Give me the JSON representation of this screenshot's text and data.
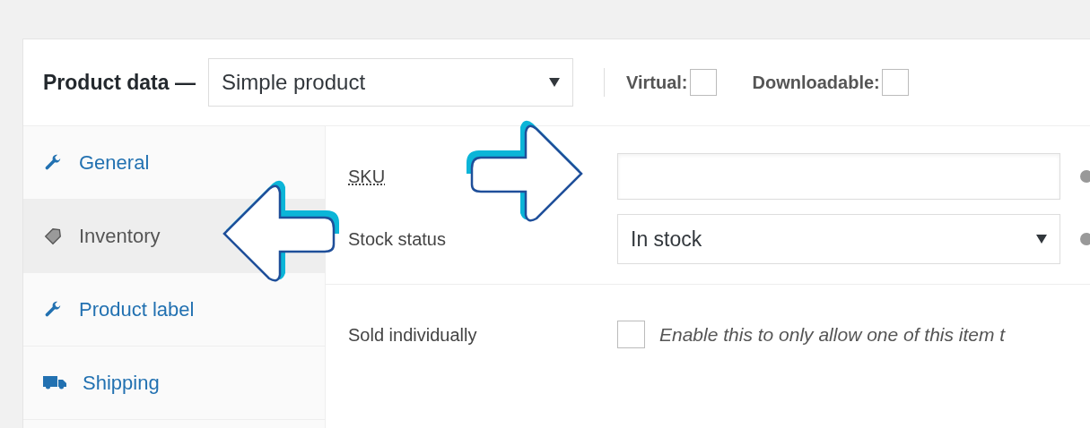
{
  "header": {
    "title": "Product data —",
    "product_type": "Simple product",
    "options": [
      {
        "label": "Virtual:",
        "checked": false
      },
      {
        "label": "Downloadable:",
        "checked": false
      }
    ]
  },
  "tabs": [
    {
      "label": "General",
      "selected": false
    },
    {
      "label": "Inventory",
      "selected": true
    },
    {
      "label": "Product label",
      "selected": false
    },
    {
      "label": "Shipping",
      "selected": false
    }
  ],
  "fields": [
    {
      "kind": "text",
      "label": "SKU"
    },
    {
      "kind": "select",
      "label": "Stock status",
      "value": "In stock"
    },
    {
      "kind": "checkbox",
      "label": "Sold individually",
      "checked": false,
      "description": "Enable this to only allow one of this item t"
    }
  ]
}
